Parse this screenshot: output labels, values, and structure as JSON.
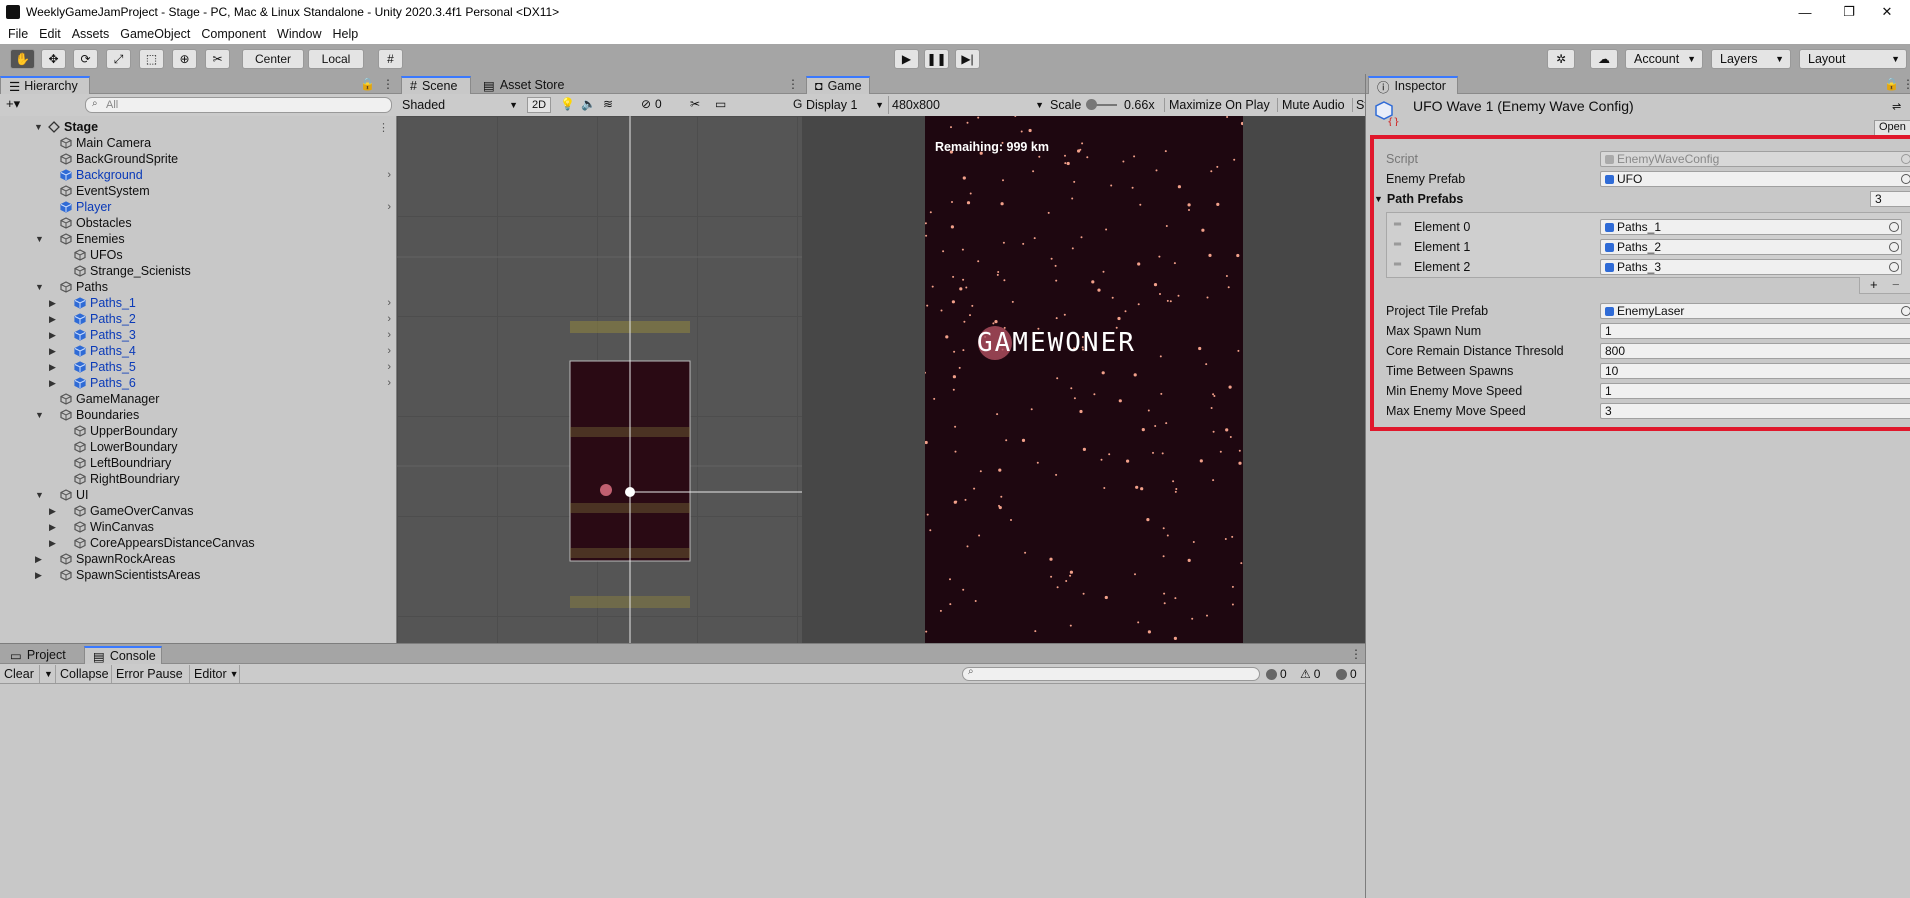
{
  "window": {
    "title": "WeeklyGameJamProject - Stage - PC, Mac & Linux Standalone - Unity 2020.3.4f1 Personal <DX11>",
    "minimize": "—",
    "restore": "❐",
    "close": "✕"
  },
  "menu": [
    "File",
    "Edit",
    "Assets",
    "GameObject",
    "Component",
    "Window",
    "Help"
  ],
  "toolbar": {
    "pivot": "Center",
    "space": "Local",
    "account": "Account",
    "layers": "Layers",
    "layout": "Layout"
  },
  "hierarchy": {
    "tab": "Hierarchy",
    "search_placeholder": "All",
    "add": "+▾",
    "scene_name": "Stage",
    "items": [
      {
        "label": "Main Camera",
        "indent": 1,
        "prefab": false,
        "fold": "",
        "chev": false
      },
      {
        "label": "BackGroundSprite",
        "indent": 1,
        "prefab": false,
        "fold": "",
        "chev": false
      },
      {
        "label": "Background",
        "indent": 1,
        "prefab": true,
        "fold": "",
        "chev": true
      },
      {
        "label": "EventSystem",
        "indent": 1,
        "prefab": false,
        "fold": "",
        "chev": false
      },
      {
        "label": "Player",
        "indent": 1,
        "prefab": true,
        "fold": "",
        "chev": true
      },
      {
        "label": "Obstacles",
        "indent": 1,
        "prefab": false,
        "fold": "",
        "chev": false
      },
      {
        "label": "Enemies",
        "indent": 1,
        "prefab": false,
        "fold": "▼",
        "chev": false
      },
      {
        "label": "UFOs",
        "indent": 2,
        "prefab": false,
        "fold": "",
        "chev": false
      },
      {
        "label": "Strange_Scienists",
        "indent": 2,
        "prefab": false,
        "fold": "",
        "chev": false
      },
      {
        "label": "Paths",
        "indent": 1,
        "prefab": false,
        "fold": "▼",
        "chev": false
      },
      {
        "label": "Paths_1",
        "indent": 2,
        "prefab": true,
        "fold": "▶",
        "chev": true
      },
      {
        "label": "Paths_2",
        "indent": 2,
        "prefab": true,
        "fold": "▶",
        "chev": true
      },
      {
        "label": "Paths_3",
        "indent": 2,
        "prefab": true,
        "fold": "▶",
        "chev": true
      },
      {
        "label": "Paths_4",
        "indent": 2,
        "prefab": true,
        "fold": "▶",
        "chev": true
      },
      {
        "label": "Paths_5",
        "indent": 2,
        "prefab": true,
        "fold": "▶",
        "chev": true
      },
      {
        "label": "Paths_6",
        "indent": 2,
        "prefab": true,
        "fold": "▶",
        "chev": true
      },
      {
        "label": "GameManager",
        "indent": 1,
        "prefab": false,
        "fold": "",
        "chev": false
      },
      {
        "label": "Boundaries",
        "indent": 1,
        "prefab": false,
        "fold": "▼",
        "chev": false
      },
      {
        "label": "UpperBoundary",
        "indent": 2,
        "prefab": false,
        "fold": "",
        "chev": false
      },
      {
        "label": "LowerBoundary",
        "indent": 2,
        "prefab": false,
        "fold": "",
        "chev": false
      },
      {
        "label": "LeftBoundriary",
        "indent": 2,
        "prefab": false,
        "fold": "",
        "chev": false
      },
      {
        "label": "RightBoundriary",
        "indent": 2,
        "prefab": false,
        "fold": "",
        "chev": false
      },
      {
        "label": "UI",
        "indent": 1,
        "prefab": false,
        "fold": "▼",
        "chev": false
      },
      {
        "label": "GameOverCanvas",
        "indent": 2,
        "prefab": false,
        "fold": "▶",
        "chev": false
      },
      {
        "label": "WinCanvas",
        "indent": 2,
        "prefab": false,
        "fold": "▶",
        "chev": false
      },
      {
        "label": "CoreAppearsDistanceCanvas",
        "indent": 2,
        "prefab": false,
        "fold": "▶",
        "chev": false
      },
      {
        "label": "SpawnRockAreas",
        "indent": 1,
        "prefab": false,
        "fold": "▶",
        "chev": false
      },
      {
        "label": "SpawnScientistsAreas",
        "indent": 1,
        "prefab": false,
        "fold": "▶",
        "chev": false
      }
    ]
  },
  "scene": {
    "tab_scene": "Scene",
    "tab_store": "Asset Store",
    "shading": "Shaded",
    "mode_2d": "2D",
    "hidden_count": "0",
    "gizmos": "G"
  },
  "game": {
    "tab": "Game",
    "display": "Display 1",
    "resolution": "480x800",
    "scale_label": "Scale",
    "scale_value": "0.66x",
    "maximize": "Maximize On Play",
    "mute": "Mute Audio",
    "stats": "St",
    "remaining": "Remaihing: 999 km",
    "overlay": "GAMEWONER"
  },
  "inspector": {
    "tab": "Inspector",
    "title": "UFO Wave 1 (Enemy Wave Config)",
    "open_button": "Open",
    "script_label": "Script",
    "script_value": "EnemyWaveConfig",
    "enemy_prefab_label": "Enemy Prefab",
    "enemy_prefab_value": "UFO",
    "path_prefabs_label": "Path Prefabs",
    "path_prefabs_count": "3",
    "elements": [
      {
        "label": "Element 0",
        "value": "Paths_1"
      },
      {
        "label": "Element 1",
        "value": "Paths_2"
      },
      {
        "label": "Element 2",
        "value": "Paths_3"
      }
    ],
    "add_symbol": "+",
    "remove_symbol": "−",
    "fields": [
      {
        "label": "Project Tile Prefab",
        "value": "EnemyLaser",
        "ref": true
      },
      {
        "label": "Max Spawn Num",
        "value": "1",
        "ref": false
      },
      {
        "label": "Core Remain Distance Thresold",
        "value": "800",
        "ref": false
      },
      {
        "label": "Time Between Spawns",
        "value": "10",
        "ref": false
      },
      {
        "label": "Min Enemy Move Speed",
        "value": "1",
        "ref": false
      },
      {
        "label": "Max Enemy Move Speed",
        "value": "3",
        "ref": false
      }
    ]
  },
  "console": {
    "tab_project": "Project",
    "tab_console": "Console",
    "clear": "Clear",
    "collapse": "Collapse",
    "error_pause": "Error Pause",
    "editor": "Editor",
    "log_count": "0",
    "warn_count": "0",
    "error_count": "0"
  },
  "colors": {
    "accent": "#3a79ff",
    "highlight": "#e0182c",
    "prefab_text": "#0a3ab8",
    "game_bg": "#1e0710"
  }
}
